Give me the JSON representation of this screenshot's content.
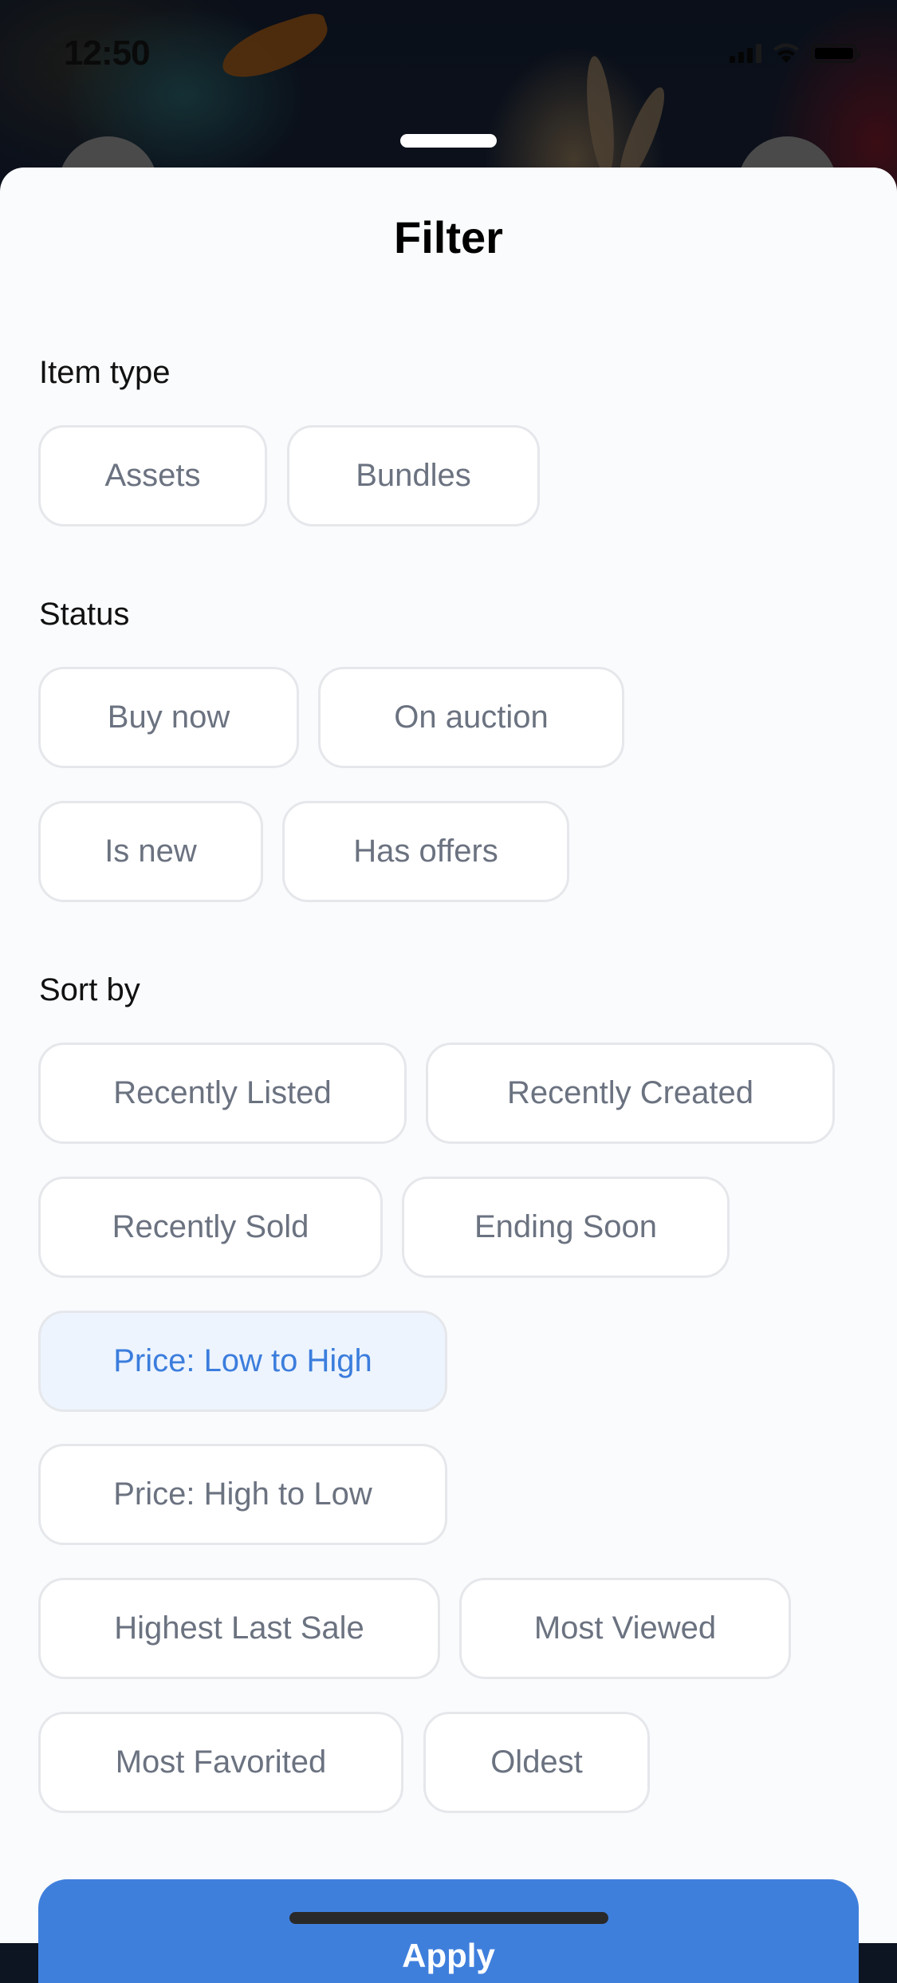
{
  "status_bar": {
    "time": "12:50",
    "icons": [
      "cellular-signal-icon",
      "wifi-icon",
      "battery-icon"
    ]
  },
  "sheet": {
    "title": "Filter",
    "sections": [
      {
        "label": "Item type",
        "options": [
          {
            "label": "Assets",
            "selected": false
          },
          {
            "label": "Bundles",
            "selected": false
          }
        ]
      },
      {
        "label": "Status",
        "options": [
          {
            "label": "Buy now",
            "selected": false
          },
          {
            "label": "On auction",
            "selected": false
          },
          {
            "label": "Is new",
            "selected": false
          },
          {
            "label": "Has offers",
            "selected": false
          }
        ]
      },
      {
        "label": "Sort by",
        "options": [
          {
            "label": "Recently Listed",
            "selected": false
          },
          {
            "label": "Recently Created",
            "selected": false
          },
          {
            "label": "Recently Sold",
            "selected": false
          },
          {
            "label": "Ending Soon",
            "selected": false
          },
          {
            "label": "Price: Low to High",
            "selected": true
          },
          {
            "label": "Price: High to Low",
            "selected": false
          },
          {
            "label": "Highest Last Sale",
            "selected": false
          },
          {
            "label": "Most Viewed",
            "selected": false
          },
          {
            "label": "Most Favorited",
            "selected": false
          },
          {
            "label": "Oldest",
            "selected": false
          }
        ]
      }
    ],
    "apply_label": "Apply"
  },
  "colors": {
    "accent": "#3f7fdc",
    "selected_bg": "#edf4fd",
    "selected_text": "#3b7ddd",
    "chip_text": "#6b7280",
    "chip_border": "#e5e7eb",
    "sheet_bg": "#fafbfd"
  }
}
